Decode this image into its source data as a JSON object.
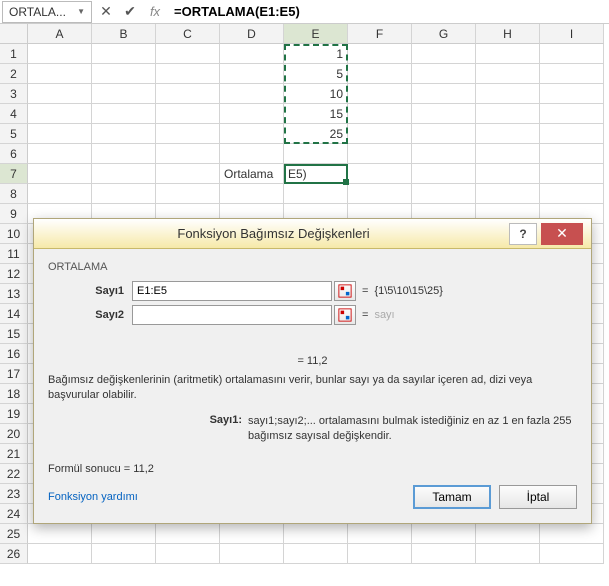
{
  "formula_bar": {
    "name_box": "ORTALA...",
    "formula": "=ORTALAMA(E1:E5)"
  },
  "columns": [
    "A",
    "B",
    "C",
    "D",
    "E",
    "F",
    "G",
    "H",
    "I"
  ],
  "active_column_index": 4,
  "rows_count": 26,
  "active_row_index": 6,
  "cells": {
    "E1": "1",
    "E2": "5",
    "E3": "10",
    "E4": "15",
    "E5": "25",
    "D7": "Ortalama",
    "E7": "E5)"
  },
  "dialog": {
    "title": "Fonksiyon Bağımsız Değişkenleri",
    "function_name": "ORTALAMA",
    "args": {
      "arg1_label": "Sayı1",
      "arg1_value": "E1:E5",
      "arg1_preview": "{1\\5\\10\\15\\25}",
      "arg2_label": "Sayı2",
      "arg2_value": "",
      "arg2_placeholder": "sayı"
    },
    "mid_result": "=   11,2",
    "description": "Bağımsız değişkenlerinin (aritmetik) ortalamasını verir, bunlar sayı ya da sayılar içeren ad, dizi veya başvurular olabilir.",
    "arg_desc_label": "Sayı1:",
    "arg_desc_text": "sayı1;sayı2;... ortalamasını bulmak istediğiniz en az 1 en fazla 255 bağımsız sayısal değişkendir.",
    "formula_result_label": "Formül sonucu =   11,2",
    "help_link": "Fonksiyon yardımı",
    "ok": "Tamam",
    "cancel": "İptal"
  }
}
